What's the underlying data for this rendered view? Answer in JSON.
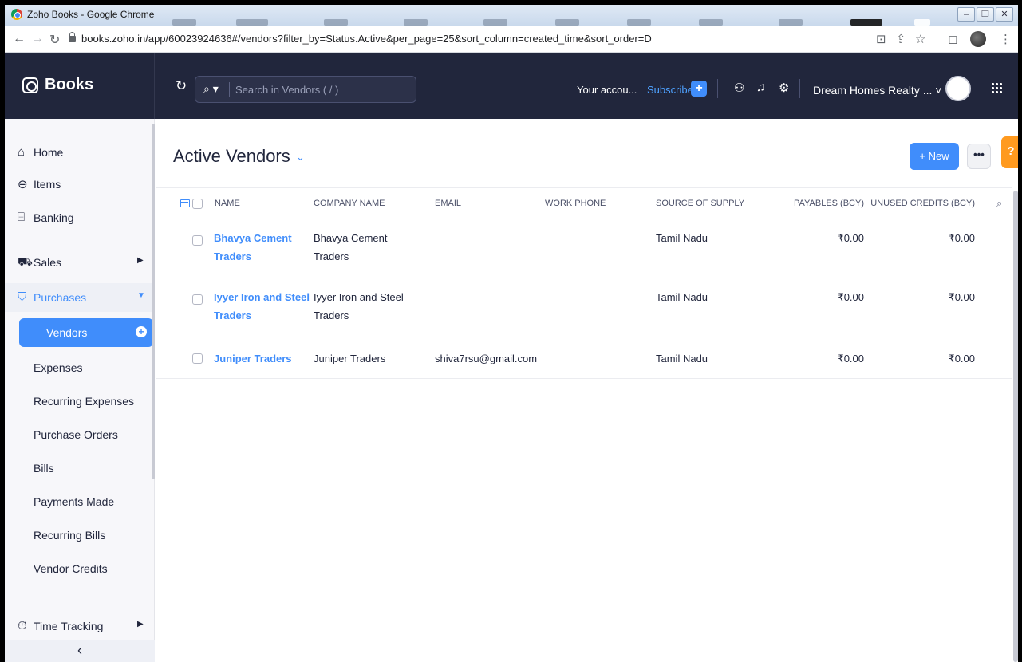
{
  "window": {
    "title": "Zoho Books - Google Chrome"
  },
  "browser": {
    "url": "books.zoho.in/app/60023924636#/vendors?filter_by=Status.Active&per_page=25&sort_column=created_time&sort_order=D"
  },
  "header": {
    "brand": "Books",
    "search_placeholder": "Search in Vendors ( / )",
    "account_text": "Your accou...",
    "subscribe_label": "Subscribe",
    "org_name": "Dream Homes Realty ...",
    "icons": [
      "refresh-icon",
      "search-icon",
      "plus-icon",
      "referral-icon",
      "bell-icon",
      "gear-icon",
      "avatar",
      "apps-grid-icon"
    ]
  },
  "sidebar": {
    "items": [
      {
        "label": "Home",
        "icon": "home-icon"
      },
      {
        "label": "Items",
        "icon": "items-bag-icon"
      },
      {
        "label": "Banking",
        "icon": "bank-icon"
      },
      {
        "label": "Sales",
        "icon": "cart-icon"
      },
      {
        "label": "Purchases",
        "icon": "shopping-bag-icon"
      },
      {
        "label": "Time Tracking",
        "icon": "stopwatch-icon"
      }
    ],
    "purchases_sub": [
      {
        "label": "Vendors"
      },
      {
        "label": "Expenses"
      },
      {
        "label": "Recurring Expenses"
      },
      {
        "label": "Purchase Orders"
      },
      {
        "label": "Bills"
      },
      {
        "label": "Payments Made"
      },
      {
        "label": "Recurring Bills"
      },
      {
        "label": "Vendor Credits"
      }
    ],
    "collapse_glyph": "‹"
  },
  "main": {
    "title": "Active Vendors",
    "new_button": "+ New",
    "more_button": "•••",
    "help_button": "?",
    "columns": [
      "NAME",
      "COMPANY NAME",
      "EMAIL",
      "WORK PHONE",
      "SOURCE OF SUPPLY",
      "PAYABLES (BCY)",
      "UNUSED CREDITS (BCY)"
    ],
    "rows": [
      {
        "name_line1": "Bhavya Cement",
        "name_line2": "Traders",
        "company_line1": "Bhavya Cement",
        "company_line2": "Traders",
        "email": "",
        "work_phone": "",
        "source_of_supply": "Tamil Nadu",
        "payables": "₹0.00",
        "unused_credits": "₹0.00"
      },
      {
        "name_line1": "Iyyer Iron and Steel",
        "name_line2": "Traders",
        "company_line1": "Iyyer Iron and Steel",
        "company_line2": "Traders",
        "email": "",
        "work_phone": "",
        "source_of_supply": "Tamil Nadu",
        "payables": "₹0.00",
        "unused_credits": "₹0.00"
      },
      {
        "name_line1": "Juniper Traders",
        "name_line2": "",
        "company_line1": "Juniper Traders",
        "company_line2": "",
        "email": "shiva7rsu@gmail.com",
        "work_phone": "",
        "source_of_supply": "Tamil Nadu",
        "payables": "₹0.00",
        "unused_credits": "₹0.00"
      }
    ]
  },
  "colors": {
    "accent": "#408dfb",
    "header_bg": "#21263c",
    "help": "#ff9a1f"
  }
}
